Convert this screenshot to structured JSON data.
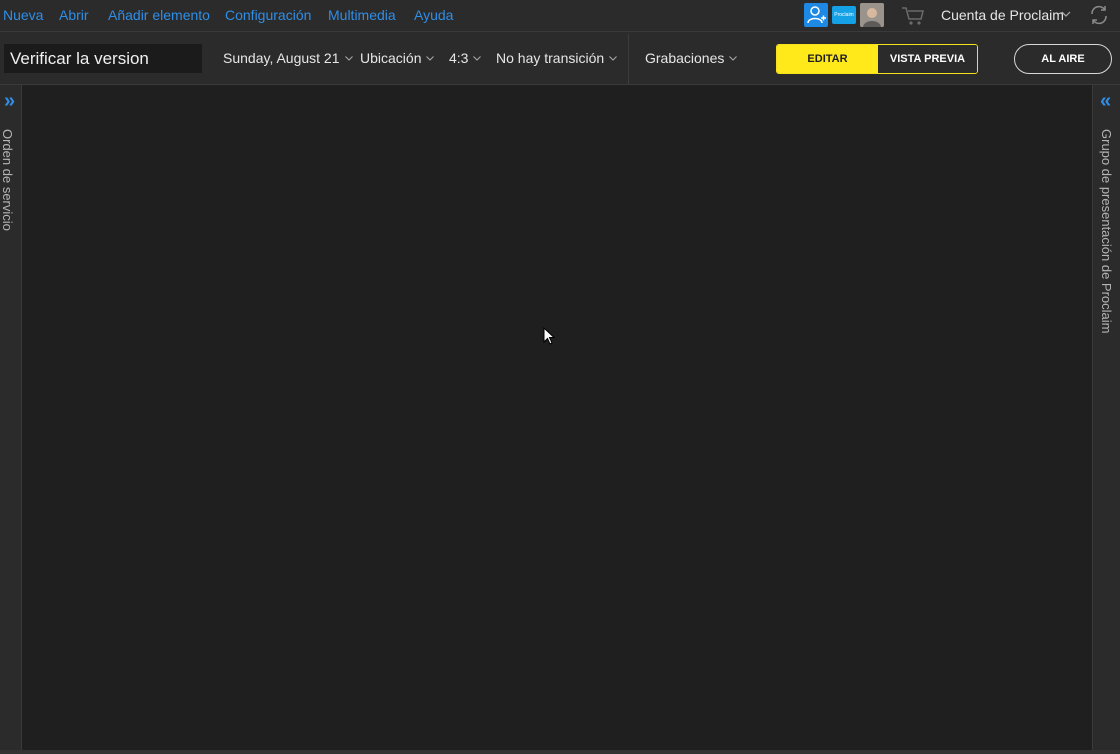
{
  "menu": {
    "items": [
      "Nueva",
      "Abrir",
      "Añadir elemento",
      "Configuración",
      "Multimedia",
      "Ayuda"
    ],
    "proclaim_badge": "Proclaim",
    "account_label": "Cuenta de Proclaim",
    "icons": [
      "user-add-icon",
      "proclaim-badge-icon",
      "avatar",
      "cart-icon",
      "sync-icon"
    ]
  },
  "toolbar": {
    "title_value": "Verificar la version",
    "date": "Sunday, August 21",
    "location": "Ubicación",
    "aspect": "4:3",
    "transition": "No hay transición",
    "recordings": "Grabaciones",
    "edit_label": "EDITAR",
    "preview_label": "VISTA PREVIA",
    "on_air_label": "AL AIRE"
  },
  "panels": {
    "left_label": "Orden de servicio",
    "left_toggle": "»",
    "right_label": "Grupo de presentación de Proclaim",
    "right_toggle": "«"
  },
  "colors": {
    "accent_blue": "#2f8ee8",
    "edit_yellow": "#ffe91a",
    "background": "#1f1f1f",
    "bar": "#2b2b2b"
  }
}
